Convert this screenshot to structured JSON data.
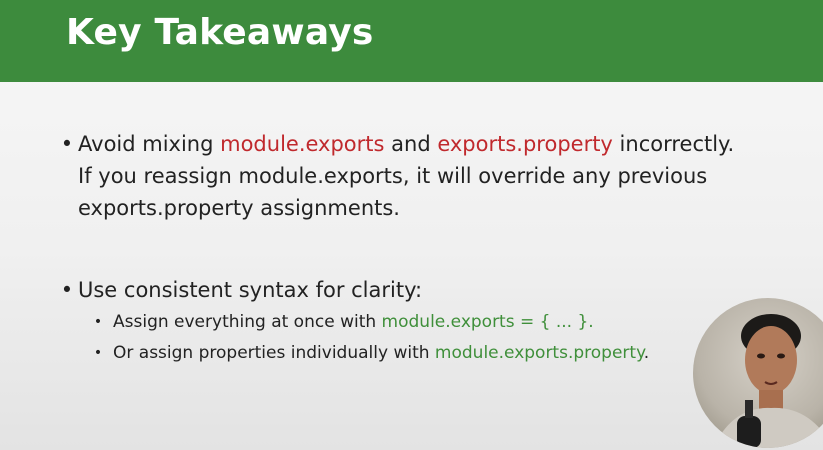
{
  "slide": {
    "title": "Key Takeaways",
    "bullets": [
      {
        "parts": [
          "Avoid mixing ",
          "module.exports",
          " and ",
          "exports.property",
          " incorrectly.",
          "If you reassign module.exports, it will override any previous exports.property assignments."
        ]
      },
      {
        "text": "Use consistent syntax for clarity:",
        "sub_items": [
          {
            "prefix": "Assign everything at once with ",
            "code": "module.exports = { ... }",
            "suffix": "."
          },
          {
            "prefix": "Or assign properties individually with ",
            "code": "module.exports.property",
            "suffix": "."
          }
        ]
      }
    ]
  },
  "colors": {
    "header_bg": "#3d8b3d",
    "header_text": "#ffffff",
    "highlight_red": "#c0292d",
    "highlight_green": "#3f8f3a",
    "body_text": "#222222"
  },
  "icons": {
    "bullet": "•"
  }
}
